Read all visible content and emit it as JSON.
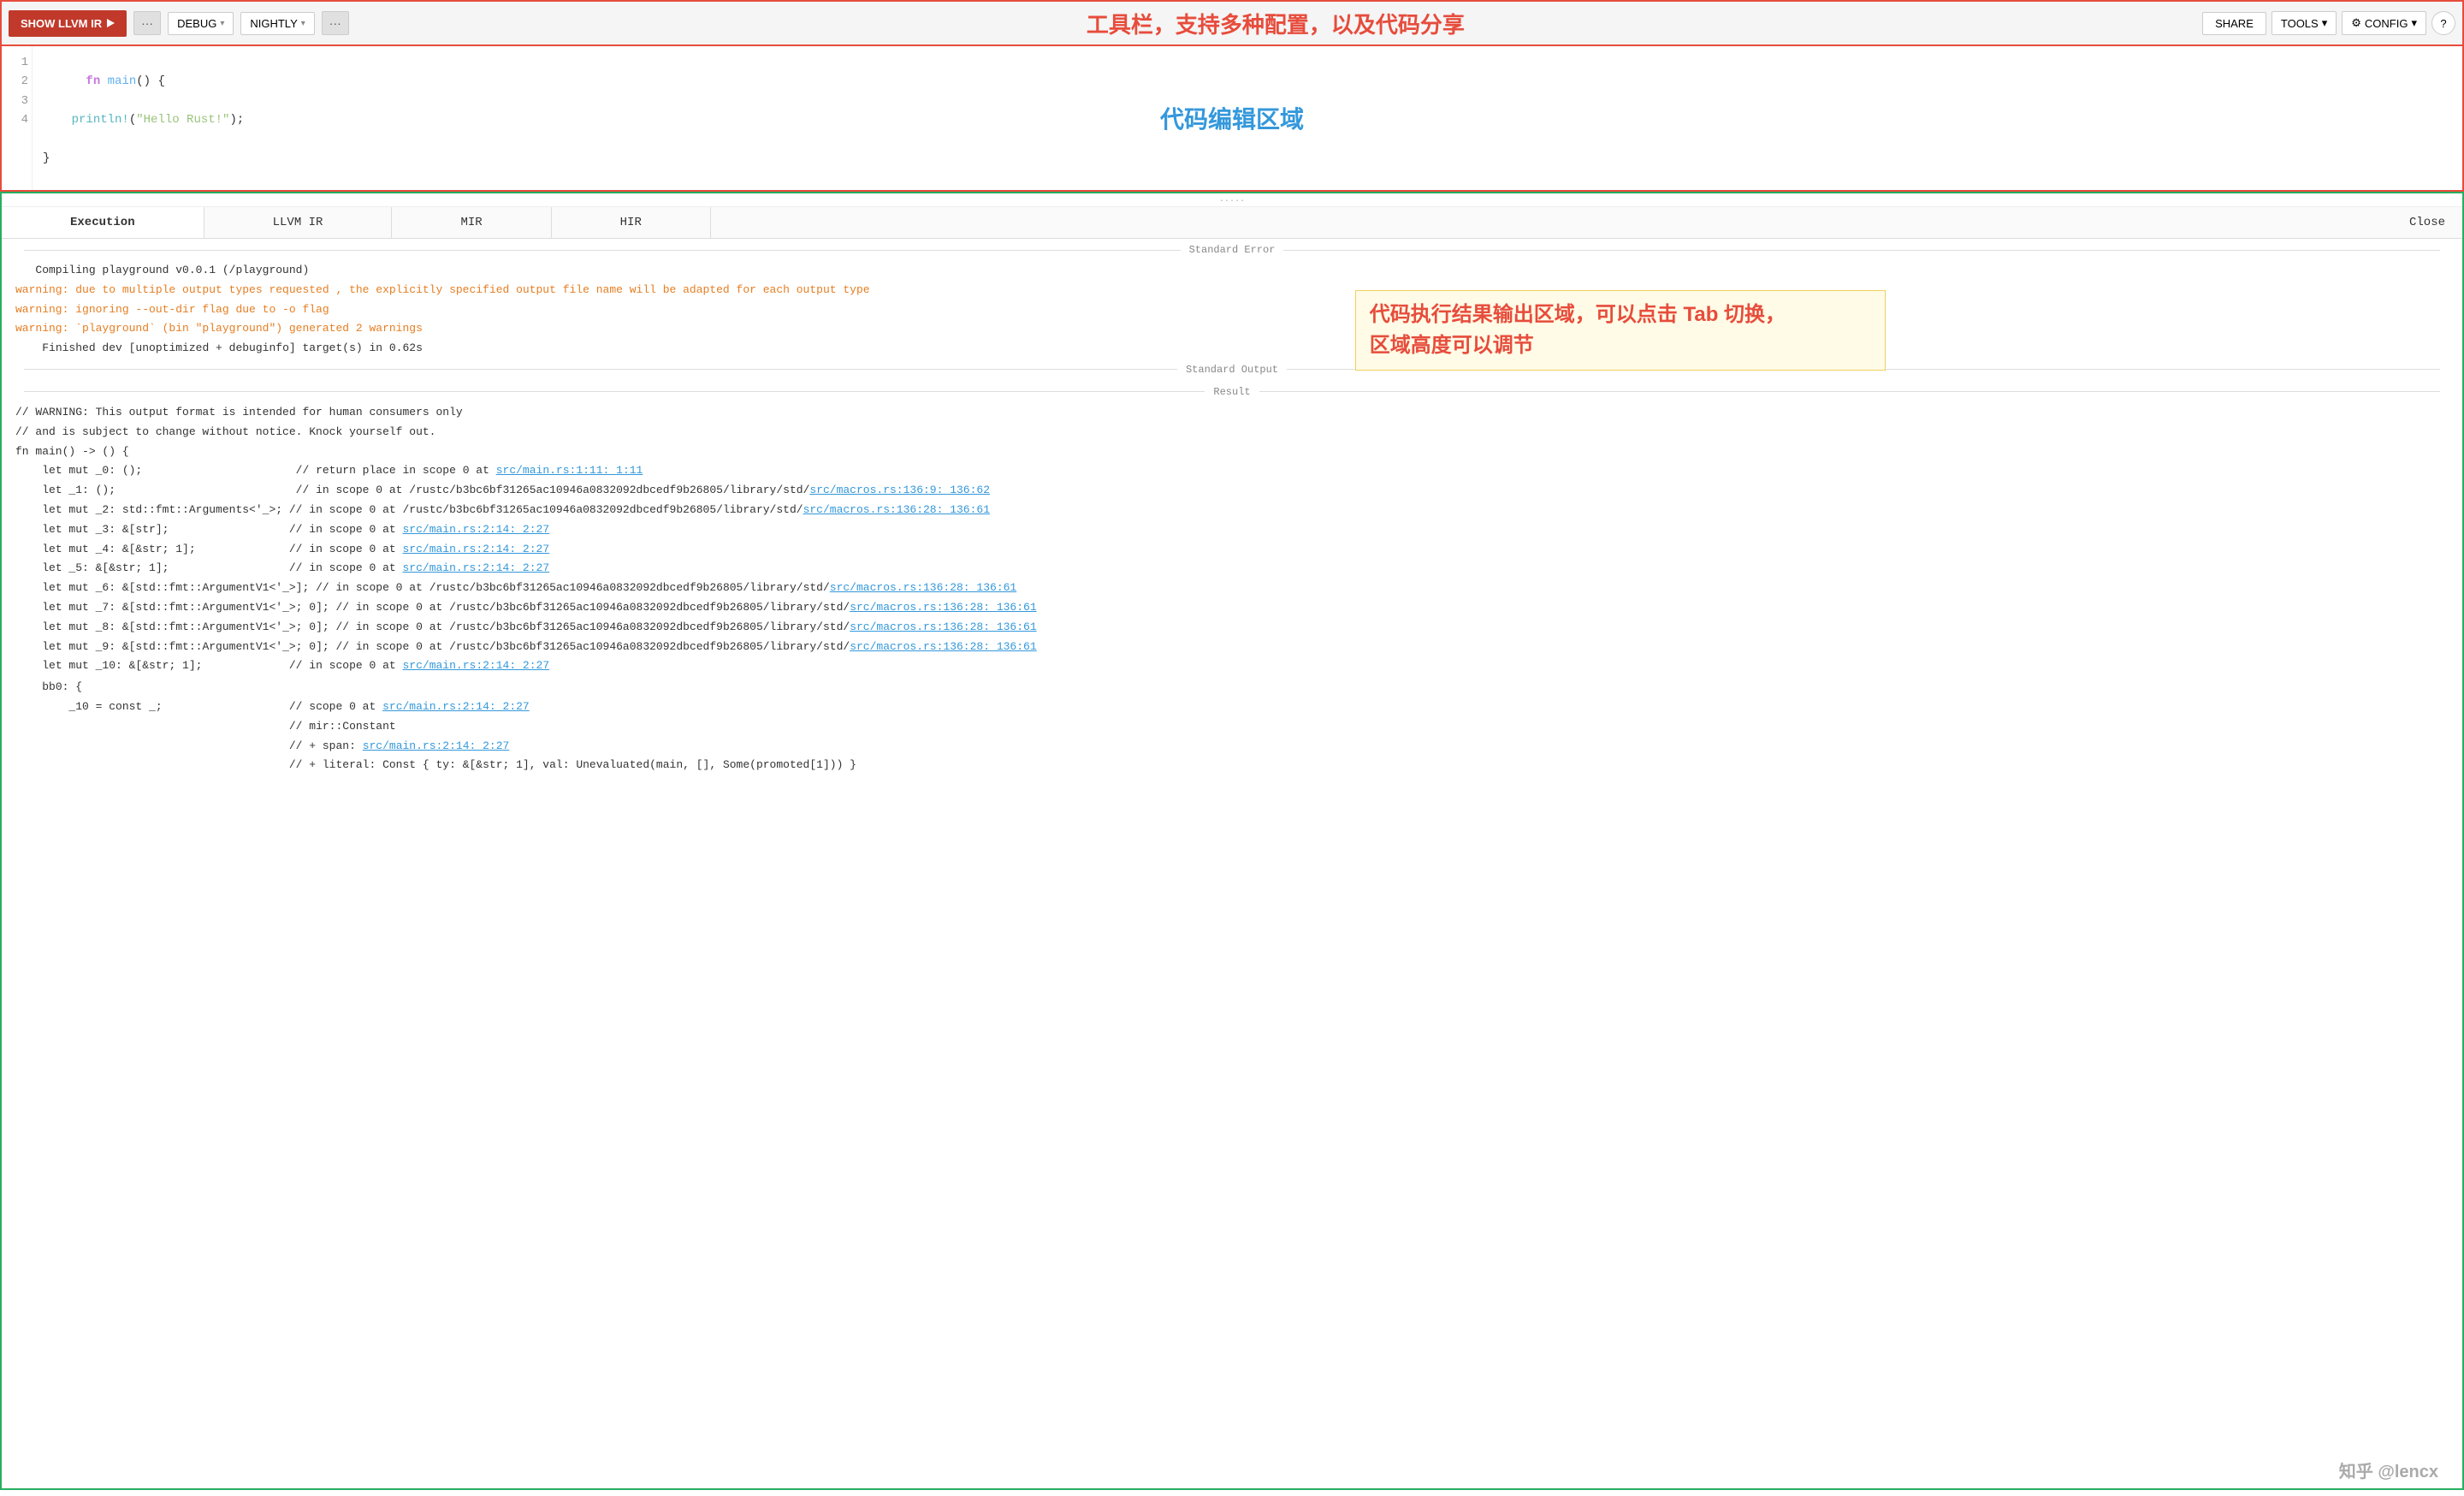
{
  "toolbar": {
    "show_llvm_label": "SHOW LLVM IR",
    "dots1_label": "···",
    "debug_label": "DEBUG",
    "nightly_label": "NIGHTLY",
    "dots2_label": "···",
    "title": "工具栏，支持多种配置，以及代码分享",
    "share_label": "SHARE",
    "tools_label": "TOOLS",
    "config_label": "CONFIG",
    "help_label": "?"
  },
  "editor": {
    "annotation": "代码编辑区域",
    "lines": [
      {
        "number": "1",
        "content": "fn main() {"
      },
      {
        "number": "2",
        "content": "    println!(\"Hello Rust!\");"
      },
      {
        "number": "3",
        "content": "}"
      },
      {
        "number": "4",
        "content": ""
      }
    ]
  },
  "output": {
    "resize_handle": ".....",
    "tabs": [
      {
        "label": "Execution",
        "active": true
      },
      {
        "label": "LLVM IR",
        "active": false
      },
      {
        "label": "MIR",
        "active": false
      },
      {
        "label": "HIR",
        "active": false
      }
    ],
    "close_label": "Close",
    "annotation": "代码执行结果输出区域，可以点击 Tab 切换，\n区域高度可以调节",
    "stderr_divider": "Standard Error",
    "stdout_divider": "Standard Output",
    "result_divider": "Result",
    "lines": [
      {
        "type": "normal",
        "text": "   Compiling playground v0.0.1 (/playground)"
      },
      {
        "type": "warning",
        "text": "warning: due to multiple output types requested , the explicitly specified output file name will be adapted for each output type"
      },
      {
        "type": "warning",
        "text": "warning: ignoring --out-dir flag due to -o flag"
      },
      {
        "type": "warning",
        "text": "warning: `playground` (bin \"playground\") generated 2 warnings"
      },
      {
        "type": "normal",
        "text": "    Finished dev [unoptimized + debuginfo] target(s) in 0.62s"
      }
    ],
    "result_lines": [
      {
        "type": "normal",
        "text": "// WARNING: This output format is intended for human consumers only"
      },
      {
        "type": "normal",
        "text": "// and is subject to change without notice. Knock yourself out."
      },
      {
        "type": "normal",
        "text": "fn main() -> () {"
      },
      {
        "type": "normal",
        "text": "    let mut _0: ();                       // return place in scope 0 at ",
        "link": "src/main.rs:1:11: 1:11",
        "href": "#"
      },
      {
        "type": "normal",
        "text": "    let _1: ();                           // in scope 0 at /rustc/b3bc6bf31265ac10946a0832092dbcedf9b26805/library/std/",
        "link": "src/macros.rs:136:9: 136:62",
        "href": "#"
      },
      {
        "type": "normal",
        "text": "    let mut _2: std::fmt::Arguments<'_>; // in scope 0 at /rustc/b3bc6bf31265ac10946a0832092dbcedf9b26805/library/std/",
        "link": "src/macros.rs:136:28: 136:61",
        "href": "#"
      },
      {
        "type": "normal",
        "text": "    let mut _3: &[str];                  // in scope 0 at ",
        "link": "src/main.rs:2:14: 2:27",
        "href": "#"
      },
      {
        "type": "normal",
        "text": "    let mut _4: &[&str; 1];              // in scope 0 at ",
        "link": "src/main.rs:2:14: 2:27",
        "href": "#"
      },
      {
        "type": "normal",
        "text": "    let _5: &[&str; 1];                  // in scope 0 at ",
        "link": "src/main.rs:2:14: 2:27",
        "href": "#"
      },
      {
        "type": "normal",
        "text": "    let mut _6: &[std::fmt::ArgumentV1<'_>]; // in scope 0 at /rustc/b3bc6bf31265ac10946a0832092dbcedf9b26805/library/std/",
        "link": "src/macros.rs:136:28: 136:61",
        "href": "#"
      },
      {
        "type": "normal",
        "text": "    let mut _7: &[std::fmt::ArgumentV1<'_>; 0]; // in scope 0 at /rustc/b3bc6bf31265ac10946a0832092dbcedf9b26805/library/std/",
        "link": "src/macros.rs:136:28: 136:61",
        "href": "#"
      },
      {
        "type": "normal",
        "text": "    let mut _8: &[std::fmt::ArgumentV1<'_>; 0]; // in scope 0 at /rustc/b3bc6bf31265ac10946a0832092dbcedf9b26805/library/std/",
        "link": "src/macros.rs:136:28: 136:61",
        "href": "#"
      },
      {
        "type": "normal",
        "text": "    let mut _9: &[std::fmt::ArgumentV1<'_>; 0]; // in scope 0 at /rustc/b3bc6bf31265ac10946a0832092dbcedf9b26805/library/std/",
        "link": "src/macros.rs:136:28: 136:61",
        "href": "#"
      },
      {
        "type": "normal",
        "text": "    let mut _10: &[&str; 1];             // in scope 0 at ",
        "link": "src/main.rs:2:14: 2:27",
        "href": "#"
      },
      {
        "type": "normal",
        "text": ""
      },
      {
        "type": "normal",
        "text": "    bb0: {"
      },
      {
        "type": "normal",
        "text": "        _10 = const _;                   // scope 0 at ",
        "link": "src/main.rs:2:14: 2:27",
        "href": "#"
      },
      {
        "type": "normal",
        "text": "                                         // mir::Constant"
      },
      {
        "type": "normal",
        "text": "                                         // + span: ",
        "link": "src/main.rs:2:14: 2:27",
        "href": "#"
      },
      {
        "type": "normal",
        "text": "                                         // + literal: Const { ty: &[&str; 1], val: Unevaluated(main, [], Some(promoted[1])) }"
      }
    ]
  },
  "watermark": "知乎 @lencx"
}
